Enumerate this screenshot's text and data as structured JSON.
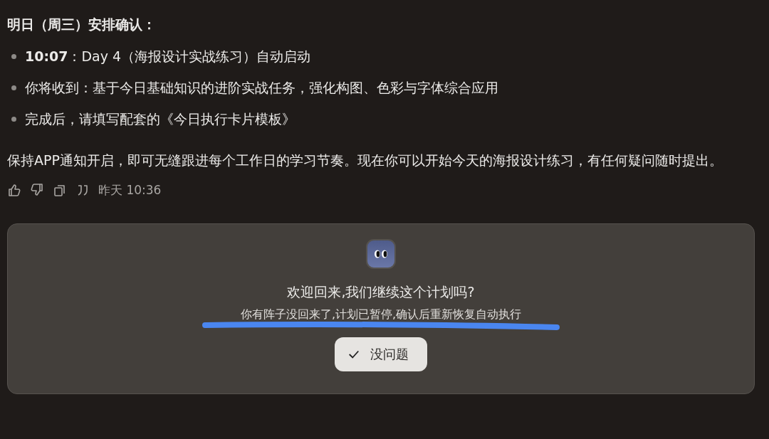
{
  "message": {
    "heading": "明日（周三）安排确认：",
    "bullets": [
      "**10:07**：Day 4（海报设计实战练习）自动启动",
      "你将收到：基于今日基础知识的进阶实战任务，强化构图、色彩与字体综合应用",
      "完成后，请填写配套的《今日执行卡片模板》"
    ],
    "paragraph": "保持APP通知开启，即可无缝跟进每个工作日的学习节奏。现在你可以开始今天的海报设计练习，有任何疑问随时提出。",
    "actions": [
      {
        "kind": "like"
      },
      {
        "kind": "dislike"
      },
      {
        "kind": "copy"
      },
      {
        "kind": "quote"
      }
    ],
    "timestamp": "昨天 10:36"
  },
  "card": {
    "title": "欢迎回来,我们继续这个计划吗?",
    "subtitle": "你有阵子没回来了,计划已暂停,确认后重新恢复自动执行",
    "button": "没问题"
  }
}
